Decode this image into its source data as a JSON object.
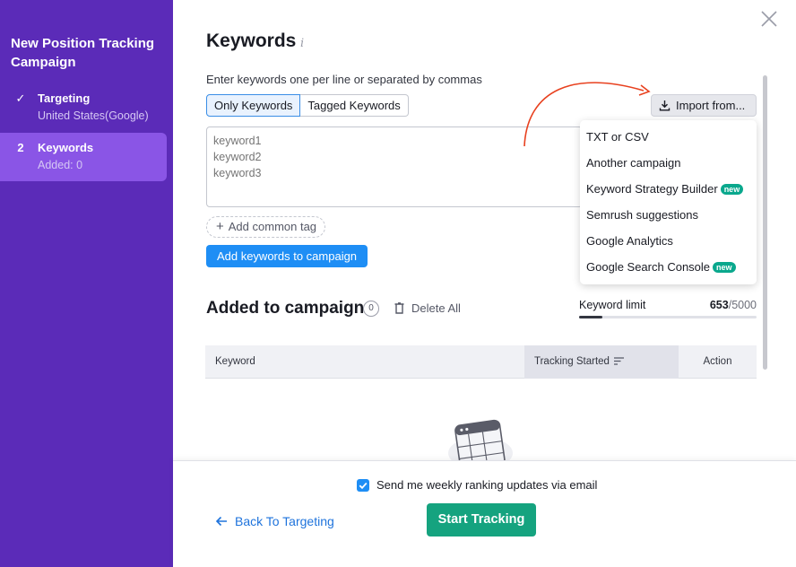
{
  "sidebar": {
    "title": "New Position Tracking Campaign",
    "steps": [
      {
        "marker": "✓",
        "label": "Targeting",
        "sub": "United States(Google)"
      },
      {
        "marker": "2",
        "label": "Keywords",
        "sub": "Added: 0"
      }
    ]
  },
  "header": {
    "title": "Keywords",
    "info": "i",
    "hint": "Enter keywords one per line or separated by commas"
  },
  "toggle": {
    "only": "Only Keywords",
    "tagged": "Tagged Keywords"
  },
  "import": {
    "label": "Import from...",
    "menu": [
      {
        "label": "TXT or CSV"
      },
      {
        "label": "Another campaign"
      },
      {
        "label": "Keyword Strategy Builder",
        "badge": "new"
      },
      {
        "label": "Semrush suggestions"
      },
      {
        "label": "Google Analytics"
      },
      {
        "label": "Google Search Console",
        "badge": "new"
      }
    ]
  },
  "keywords_input": {
    "placeholder": "keyword1\nkeyword2\nkeyword3"
  },
  "add_tag": {
    "plus": "+",
    "label": "Add common tag"
  },
  "add_keywords_label": "Add keywords to campaign",
  "added": {
    "title": "Added to campaign",
    "count": "0",
    "delete_all": "Delete All",
    "limit_label": "Keyword limit",
    "limit_used": "653",
    "limit_total": "/5000",
    "limit_fraction": 0.1306
  },
  "table": {
    "col_keyword": "Keyword",
    "col_tracking": "Tracking Started",
    "col_action": "Action"
  },
  "footer": {
    "email_label": "Send me weekly ranking updates via email",
    "email_checked": true,
    "back_label": "Back To Targeting",
    "start_label": "Start Tracking"
  },
  "colors": {
    "sidebar": "#5b2bb8",
    "active_step": "#8a55e6",
    "primary_blue": "#1e8ef5",
    "start_green": "#15a37f",
    "badge_green": "#0aa88d",
    "annotation_red": "#e8411f"
  }
}
